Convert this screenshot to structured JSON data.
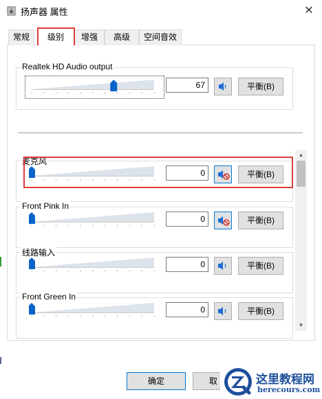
{
  "window": {
    "title": "扬声器 属性",
    "close_glyph": "✕"
  },
  "tabs": [
    {
      "label": "常规"
    },
    {
      "label": "级别"
    },
    {
      "label": "增强"
    },
    {
      "label": "高级"
    },
    {
      "label": "空间音效"
    }
  ],
  "output": {
    "label": "Realtek HD Audio output",
    "level": "67",
    "level_fraction": 0.67,
    "balance_label": "平衡(B)"
  },
  "inputs": [
    {
      "label": "麦克风",
      "level": "0",
      "level_fraction": 0.0,
      "muted": true,
      "balance_label": "平衡(B)"
    },
    {
      "label": "Front Pink In",
      "level": "0",
      "level_fraction": 0.0,
      "muted": true,
      "balance_label": "平衡(B)"
    },
    {
      "label": "线路输入",
      "level": "0",
      "level_fraction": 0.0,
      "muted": false,
      "balance_label": "平衡(B)"
    },
    {
      "label": "Front Green In",
      "level": "0",
      "level_fraction": 0.0,
      "muted": false,
      "balance_label": "平衡(B)"
    }
  ],
  "footer": {
    "ok_label": "确定",
    "cancel_label": "取"
  },
  "watermark": {
    "title": "这里教程网",
    "url": "herecours.com"
  },
  "colors": {
    "highlight_red": "#e03c3c",
    "thumb_blue": "#0a64c8",
    "icon_blue": "#1f6fd6",
    "mute_red": "#d0312d"
  }
}
